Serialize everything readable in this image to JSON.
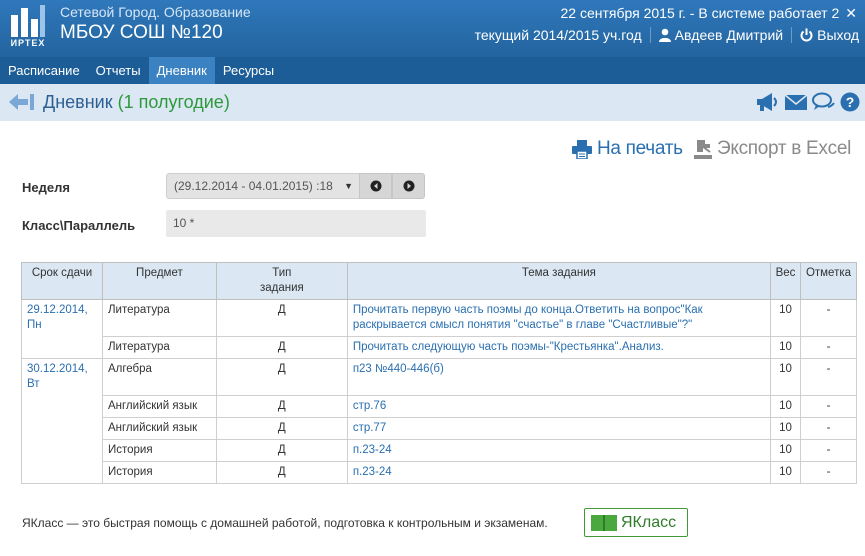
{
  "header": {
    "logo_text": "ИРТЕХ",
    "app_name": "Сетевой Город. Образование",
    "school": "МБОУ СОШ №120",
    "system_line": "22 сентября 2015 г. - В системе работает 2",
    "close_symbol": "✕",
    "year": "текущий 2014/2015 уч.год",
    "user": "Авдеев Дмитрий",
    "logout": "Выход",
    "background": "#2a6fb0"
  },
  "nav": {
    "items": [
      "Расписание",
      "Отчеты",
      "Дневник",
      "Ресурсы"
    ],
    "active": "Дневник"
  },
  "titlebar": {
    "title": "Дневник",
    "period": "(1 полугодие)"
  },
  "actions": {
    "print": "На печать",
    "excel": "Экспорт в Excel"
  },
  "form": {
    "week_label": "Неделя",
    "week_value": "(29.12.2014 - 04.01.2015) :18",
    "class_label": "Класс\\Параллель",
    "class_value": "10 *"
  },
  "table": {
    "headers": {
      "date": "Срок сдачи",
      "subject": "Предмет",
      "type": "Тип задания",
      "topic": "Тема задания",
      "weight": "Вес",
      "mark": "Отметка"
    },
    "rows": [
      {
        "date": "29.12.2014, Пн",
        "subject": "Литература",
        "type": "Д",
        "topic": "Прочитать первую часть поэмы до конца.Ответить на вопрос\"Как раскрывается смысл понятия \"счастье\" в главе \"Счастливые\"?\"",
        "weight": "10",
        "mark": "-"
      },
      {
        "date": "",
        "subject": "Литература",
        "type": "Д",
        "topic": "Прочитать следующую часть поэмы-\"Крестьянка\".Анализ.",
        "weight": "10",
        "mark": "-"
      },
      {
        "date": "30.12.2014, Вт",
        "subject": "Алгебра",
        "type": "Д",
        "topic": "п23 №440-446(б)",
        "weight": "10",
        "mark": "-"
      },
      {
        "date": "",
        "subject": "Английский язык",
        "type": "Д",
        "topic": "стр.76",
        "weight": "10",
        "mark": "-"
      },
      {
        "date": "",
        "subject": "Английский язык",
        "type": "Д",
        "topic": "стр.77",
        "weight": "10",
        "mark": "-"
      },
      {
        "date": "",
        "subject": "История",
        "type": "Д",
        "topic": "п.23-24",
        "weight": "10",
        "mark": "-"
      },
      {
        "date": "",
        "subject": "История",
        "type": "Д",
        "topic": "п.23-24",
        "weight": "10",
        "mark": "-"
      }
    ]
  },
  "footer": {
    "promo": "ЯКласс — это быстрая помощь с домашней работой, подготовка к контрольным и экзаменам.",
    "yaklass": "ЯКласс"
  },
  "icons": {
    "back": "arrow-left-icon",
    "announce": "megaphone-icon",
    "mail": "envelope-icon",
    "chat": "chat-icon",
    "help": "question-icon",
    "print": "printer-icon",
    "excel": "export-icon",
    "user": "user-icon",
    "logout": "power-icon"
  }
}
